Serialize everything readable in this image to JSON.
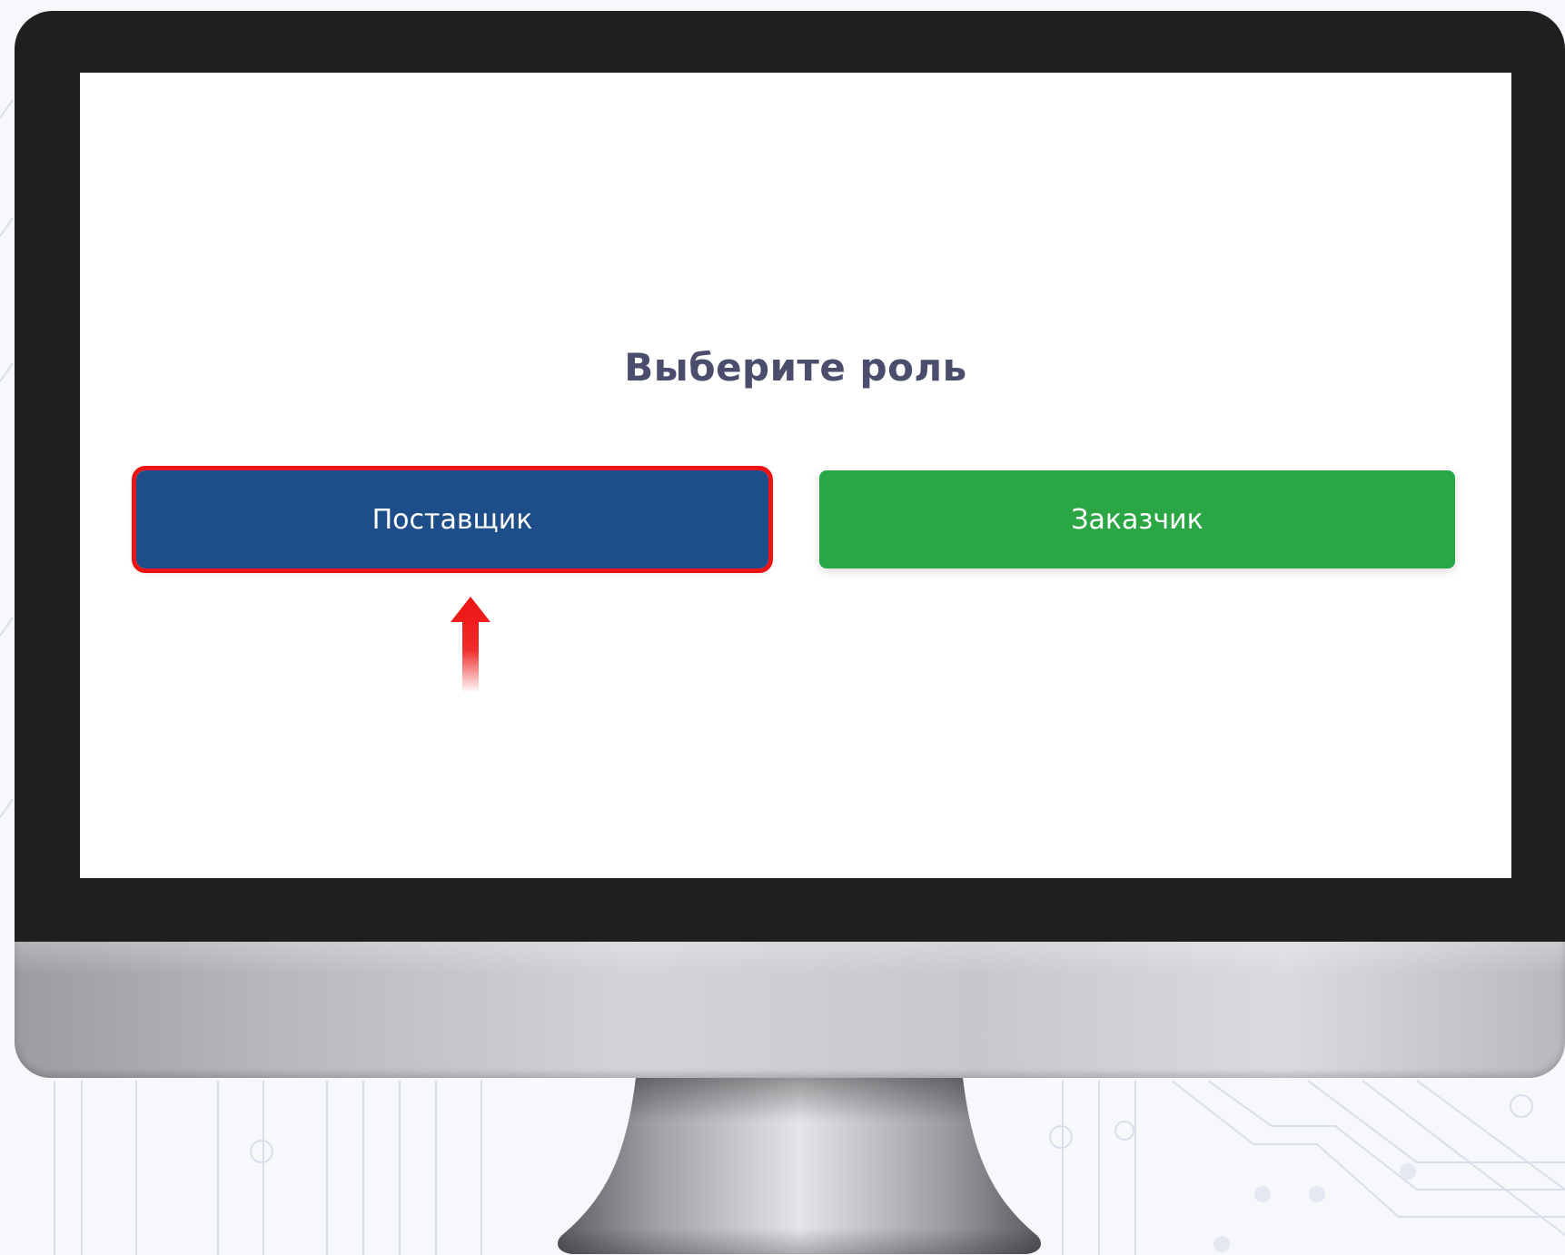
{
  "screen": {
    "title": "Выберите роль",
    "buttons": {
      "supplier": {
        "label": "Поставщик",
        "color": "#1e4e8a",
        "highlighted": true,
        "highlight_color": "#ee1313"
      },
      "customer": {
        "label": "Заказчик",
        "color": "#2ba645"
      }
    }
  },
  "annotation": {
    "pointer": "red-up-arrow-icon",
    "points_to": "supplier"
  },
  "device": {
    "type": "desktop-monitor",
    "bezel_color": "#1f1f1f"
  }
}
